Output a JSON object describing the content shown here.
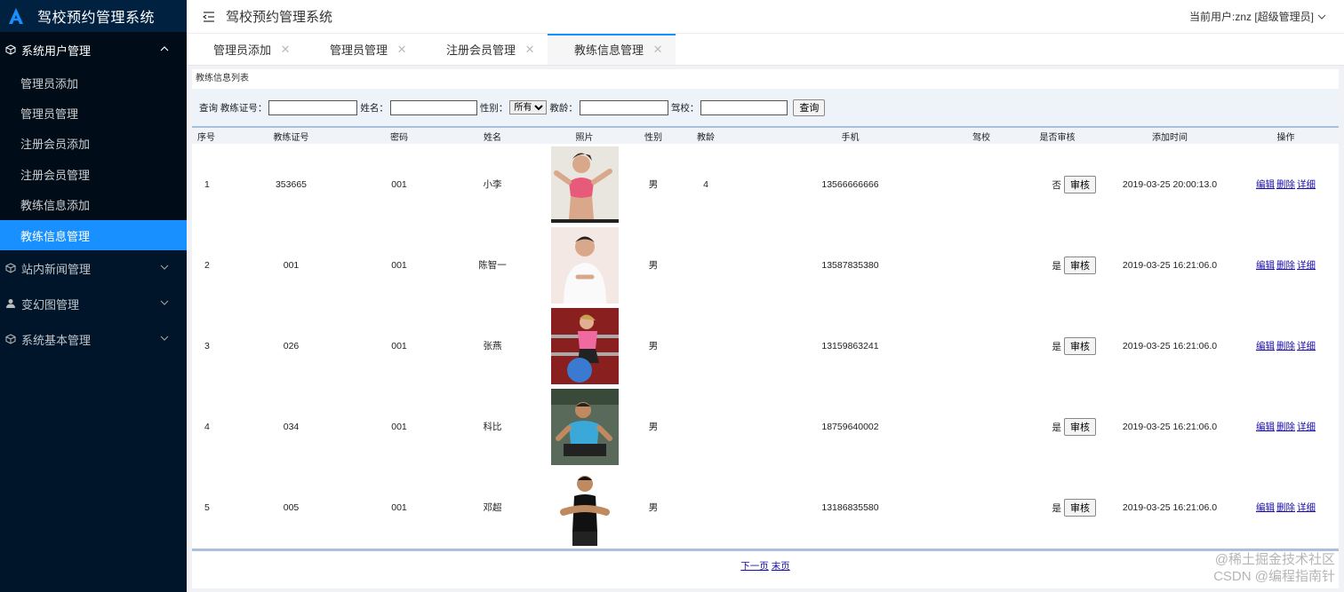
{
  "brand": {
    "title": "驾校预约管理系统"
  },
  "sidebar": {
    "groups": [
      {
        "label": "系统用户管理",
        "icon": "cube-icon",
        "open": true,
        "items": [
          {
            "label": "管理员添加"
          },
          {
            "label": "管理员管理"
          },
          {
            "label": "注册会员添加"
          },
          {
            "label": "注册会员管理"
          },
          {
            "label": "教练信息添加"
          },
          {
            "label": "教练信息管理",
            "active": true
          }
        ]
      },
      {
        "label": "站内新闻管理",
        "icon": "cube-icon"
      },
      {
        "label": "变幻图管理",
        "icon": "user-icon"
      },
      {
        "label": "系统基本管理",
        "icon": "cube-icon"
      }
    ]
  },
  "header": {
    "title": "驾校预约管理系统",
    "current_user": "当前用户:znz [超级管理员]"
  },
  "tabs": [
    {
      "label": "管理员添加"
    },
    {
      "label": "管理员管理"
    },
    {
      "label": "注册会员管理"
    },
    {
      "label": "教练信息管理",
      "active": true
    }
  ],
  "page": {
    "caption": "教练信息列表",
    "search": {
      "prefix": "查询",
      "license_label": "教练证号：",
      "name_label": "姓名：",
      "gender_label": "性别：",
      "gender_selected": "所有",
      "teach_age_label": "教龄：",
      "school_label": "驾校：",
      "button": "查询"
    },
    "columns": [
      "序号",
      "教练证号",
      "密码",
      "姓名",
      "照片",
      "性别",
      "教龄",
      "手机",
      "驾校",
      "是否审核",
      "添加时间",
      "操作"
    ],
    "rows": [
      {
        "no": "1",
        "license": "353665",
        "password": "001",
        "name": "小李",
        "gender": "男",
        "teach_age": "4",
        "phone": "13566666666",
        "school": "",
        "audited": "否",
        "audit_btn": "审核",
        "added": "2019-03-25 20:00:13.0",
        "ops": [
          "编辑",
          "删除",
          "详细"
        ]
      },
      {
        "no": "2",
        "license": "001",
        "password": "001",
        "name": "陈智一",
        "gender": "男",
        "teach_age": "",
        "phone": "13587835380",
        "school": "",
        "audited": "是",
        "audit_btn": "审核",
        "added": "2019-03-25 16:21:06.0",
        "ops": [
          "编辑",
          "删除",
          "详细"
        ]
      },
      {
        "no": "3",
        "license": "026",
        "password": "001",
        "name": "张燕",
        "gender": "男",
        "teach_age": "",
        "phone": "13159863241",
        "school": "",
        "audited": "是",
        "audit_btn": "审核",
        "added": "2019-03-25 16:21:06.0",
        "ops": [
          "编辑",
          "删除",
          "详细"
        ]
      },
      {
        "no": "4",
        "license": "034",
        "password": "001",
        "name": "科比",
        "gender": "男",
        "teach_age": "",
        "phone": "18759640002",
        "school": "",
        "audited": "是",
        "audit_btn": "审核",
        "added": "2019-03-25 16:21:06.0",
        "ops": [
          "编辑",
          "删除",
          "详细"
        ]
      },
      {
        "no": "5",
        "license": "005",
        "password": "001",
        "name": "邓超",
        "gender": "男",
        "teach_age": "",
        "phone": "13186835580",
        "school": "",
        "audited": "是",
        "audit_btn": "审核",
        "added": "2019-03-25 16:21:06.0",
        "ops": [
          "编辑",
          "删除",
          "详细"
        ]
      }
    ],
    "pager": {
      "next": "下一页",
      "last": "末页"
    }
  },
  "watermark": {
    "line1": "@稀土掘金技术社区",
    "line2": "CSDN @编程指南针"
  },
  "colors": {
    "sidebar_bg": "#001529",
    "accent": "#1890ff",
    "table_border": "#a8c0dc",
    "link": "#1a0dab"
  }
}
